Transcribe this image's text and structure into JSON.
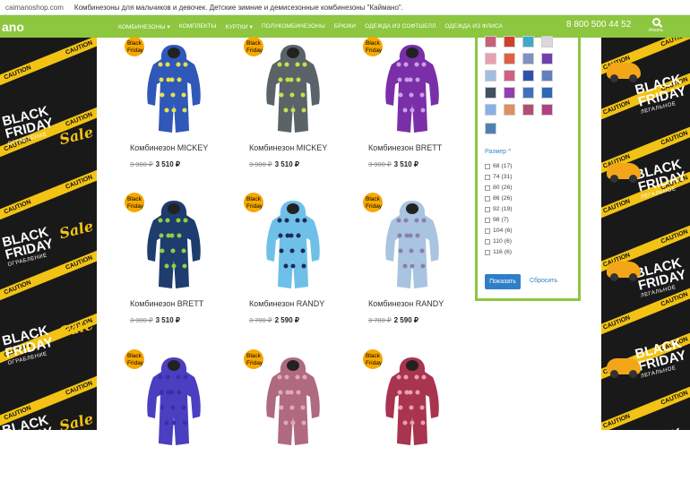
{
  "browser": {
    "host": "caimanoshop.com",
    "title": "Комбинезоны для мальчиков и девочек. Детские зимние и демисезонные комбинезоны \"Кайманo\"."
  },
  "nav": {
    "logo": "ano",
    "items": [
      "КОМБИНЕЗОНЫ ▾",
      "КОМПЛЕКТЫ",
      "КУРТКИ ▾",
      "ПОЛУКОМБИНЕЗОНЫ",
      "БРЮКИ",
      "ОДЕЖДА ИЗ СОФТШЕЛЛ",
      "ОДЕЖДА ИЗ ФЛИСА"
    ],
    "phone": "8 800 500 44 52",
    "search_label": "Искать"
  },
  "banner": {
    "tape_word": "CAUTION",
    "black_friday": "BLACK FRIDAY",
    "left_caption": "ОГРАБЛЕНИЕ",
    "right_caption": "ЛЕГАЛЬНОЕ",
    "sale": "Sale"
  },
  "colors": {
    "brand_green": "#8dc63f",
    "badge_orange": "#f7a800",
    "button_blue": "#2f7fc8"
  },
  "products": [
    {
      "badge": "Black Friday",
      "name": "Комбинезон MICKEY",
      "old_price": "3 900 ₽",
      "price": "3 510 ₽",
      "color": "#2f58b8",
      "accent": "#e7e34a"
    },
    {
      "badge": "Black Friday",
      "name": "Комбинезон MICKEY",
      "old_price": "3 900 ₽",
      "price": "3 510 ₽",
      "color": "#5a6468",
      "accent": "#c8e04a"
    },
    {
      "badge": "Black Friday",
      "name": "Комбинезон BRETT",
      "old_price": "3 900 ₽",
      "price": "3 510 ₽",
      "color": "#7a2fa8",
      "accent": "#c9a0e8"
    },
    {
      "badge": "Black Friday",
      "name": "Комбинезон BRETT",
      "old_price": "3 900 ₽",
      "price": "3 510 ₽",
      "color": "#1e3c6e",
      "accent": "#8fd040"
    },
    {
      "badge": "Black Friday",
      "name": "Комбинезон RANDY",
      "old_price": "3 700 ₽",
      "price": "2 590 ₽",
      "color": "#6ec0e8",
      "accent": "#1e2a5a"
    },
    {
      "badge": "Black Friday",
      "name": "Комбинезон RANDY",
      "old_price": "3 700 ₽",
      "price": "2 590 ₽",
      "color": "#a9c4e0",
      "accent": "#8a7fa8"
    },
    {
      "badge": "Black Friday",
      "name": "",
      "old_price": "",
      "price": "",
      "color": "#4a3fc0",
      "accent": "#3a2fa8"
    },
    {
      "badge": "Black Friday",
      "name": "",
      "old_price": "",
      "price": "",
      "color": "#b06a80",
      "accent": "#e2a8b8"
    },
    {
      "badge": "Black Friday",
      "name": "",
      "old_price": "",
      "price": "",
      "color": "#a83450",
      "accent": "#e8a0b0"
    }
  ],
  "filter": {
    "swatch_colors": [
      "#c8607a",
      "#d0402a",
      "#40a8c8",
      "#d8d8d8",
      "#e8a0b0",
      "#e06040",
      "#8090c0",
      "#7040b0",
      "#a0c0e0",
      "#d06080",
      "#3050b0",
      "#6080c0",
      "#405060",
      "#9040b0",
      "#4070c0",
      "#3068b8",
      "#8ab0e8",
      "#e09060",
      "#b05070",
      "#b04080",
      "#5080b0"
    ],
    "size_heading": "Размер ^",
    "sizes": [
      "68 (17)",
      "74 (31)",
      "80 (26)",
      "86 (26)",
      "92 (19)",
      "98 (7)",
      "104 (6)",
      "110 (6)",
      "116 (6)"
    ],
    "apply_label": "Показать",
    "reset_label": "Сбросить"
  }
}
